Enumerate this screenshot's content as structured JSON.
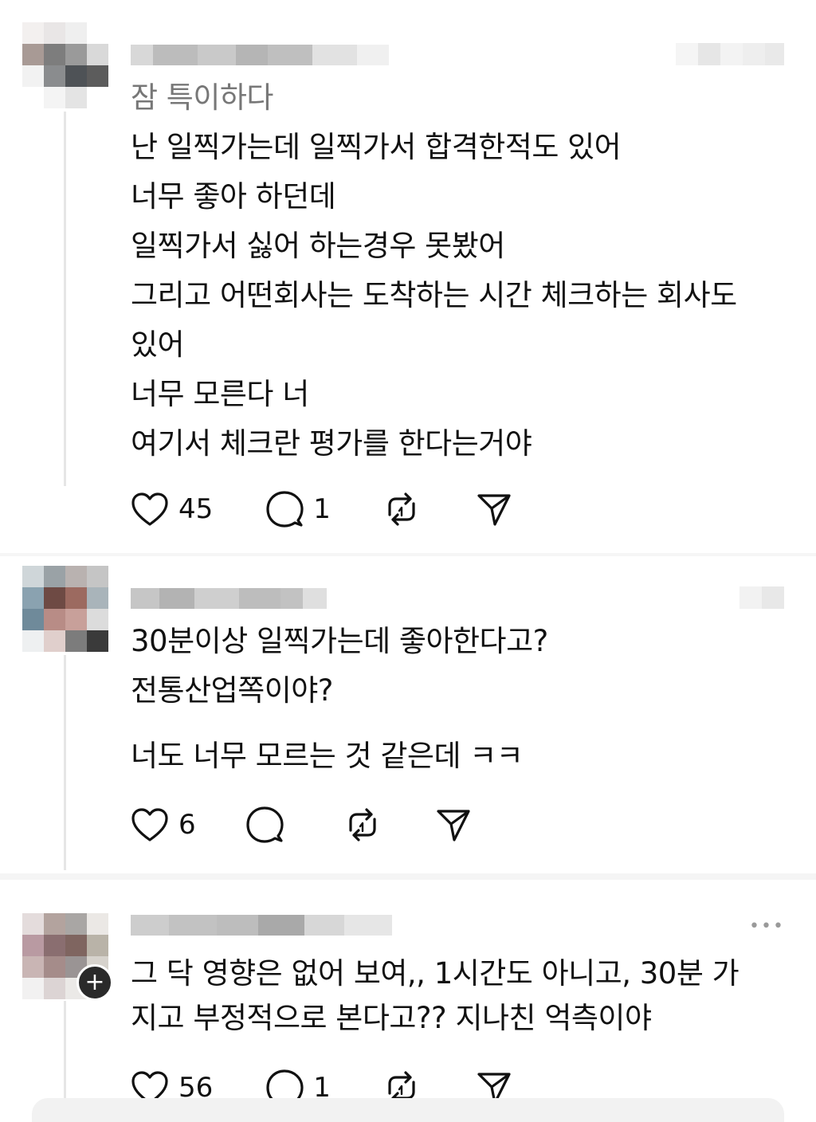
{
  "comments": [
    {
      "lines": [
        "잠 특이하다",
        "난 일찍가는데 일찍가서 합격한적도 있어",
        "너무 좋아 하던데",
        "일찍가서 싫어 하는경우 못봤어",
        "그리고 어떤회사는 도착하는 시간 체크하는 회사도",
        "있어",
        "너무 모른다 너",
        "여기서 체크란 평가를 한다는거야"
      ],
      "likes": "45",
      "replies": "1"
    },
    {
      "lines": [
        "30분이상 일찍가는데 좋아한다고?",
        "전통산업쪽이야?",
        "",
        "너도 너무 모르는 것 같은데 ㅋㅋ"
      ],
      "likes": "6",
      "replies": ""
    },
    {
      "lines": [
        "그 닥 영향은 없어 보여,, 1시간도 아니고, 30분 가",
        "지고 부정적으로 본다고?? 지나친 억측이야"
      ],
      "likes": "56",
      "replies": "1"
    }
  ],
  "icons": {
    "like": "heart-icon",
    "reply": "speech-bubble-icon",
    "repost": "repost-icon",
    "share": "send-icon",
    "more": "more-dots-icon",
    "follow": "plus-icon"
  },
  "more_label": "•••",
  "follow_label": "+"
}
